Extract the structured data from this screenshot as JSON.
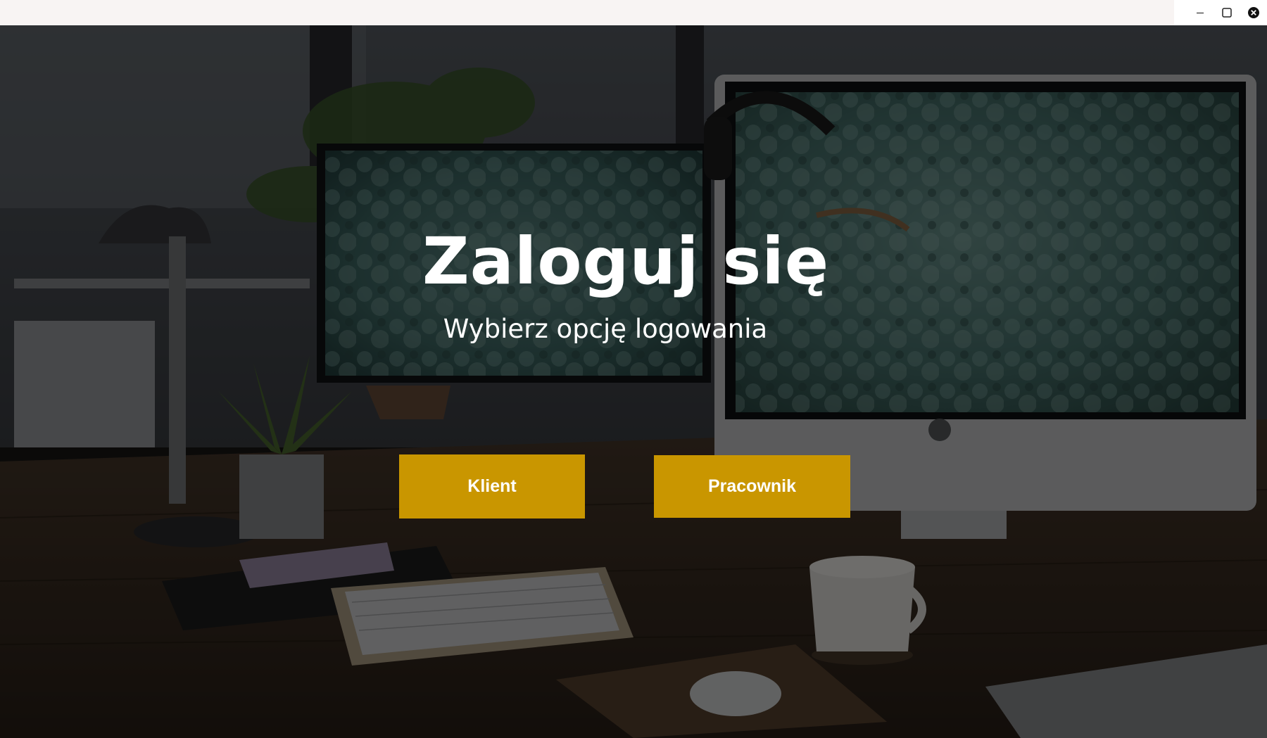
{
  "window": {
    "controls": {
      "minimize_icon": "minimize-icon",
      "maximize_icon": "maximize-icon",
      "close_icon": "close-icon"
    }
  },
  "login": {
    "title": "Zaloguj się",
    "subtitle": "Wybierz opcję logowania",
    "buttons": {
      "client_label": "Klient",
      "employee_label": "Pracownik"
    }
  },
  "colors": {
    "accent": "#c99600",
    "titlebar": "#f8f4f3",
    "text": "#ffffff"
  }
}
